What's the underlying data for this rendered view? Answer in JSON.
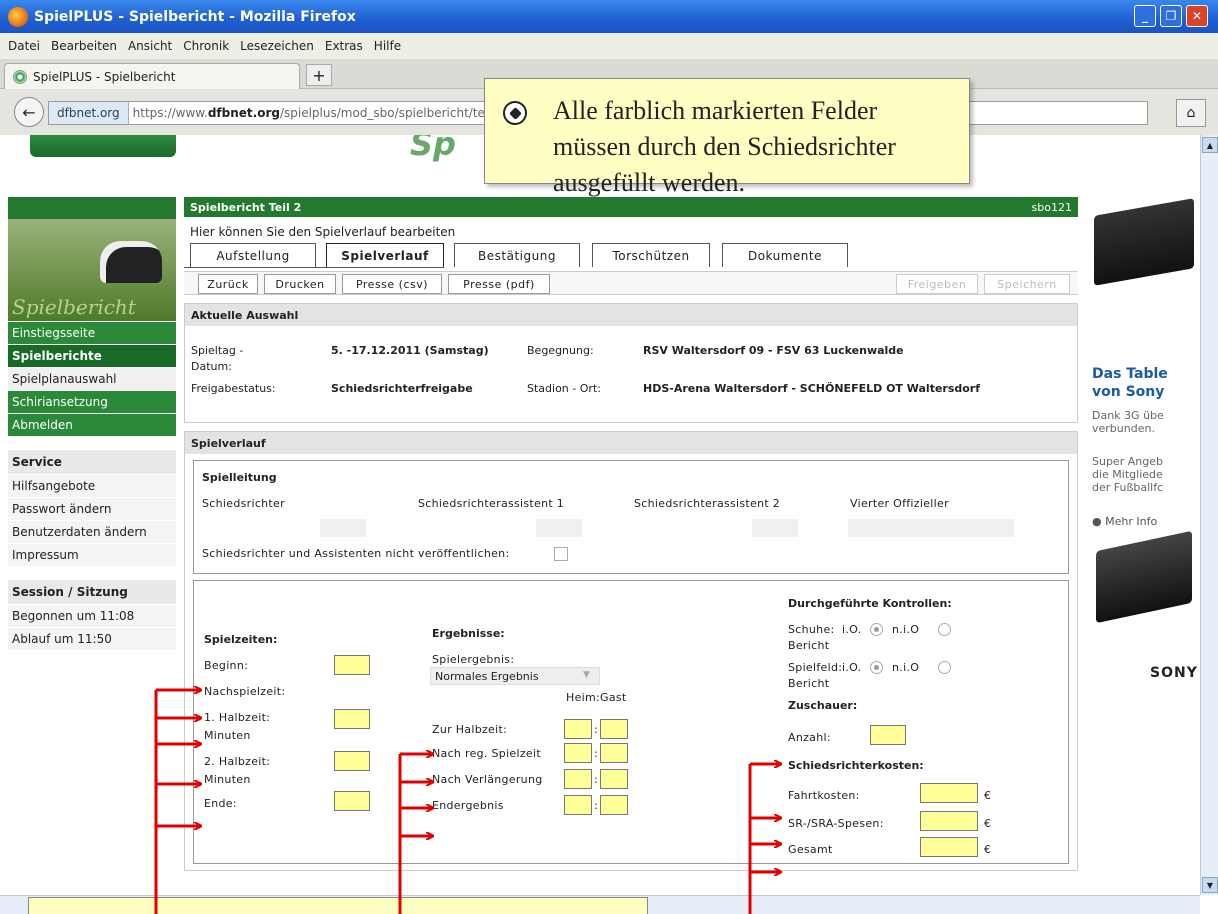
{
  "window": {
    "title": "SpielPLUS - Spielbericht - Mozilla Firefox"
  },
  "menu": [
    "Datei",
    "Bearbeiten",
    "Ansicht",
    "Chronik",
    "Lesezeichen",
    "Extras",
    "Hilfe"
  ],
  "browser_tab": {
    "label": "SpielPLUS - Spielbericht",
    "new_tab": "+"
  },
  "url": {
    "site": "dfbnet.org",
    "prefix": "https://www.",
    "domain": "dfbnet.org",
    "path": "/spielplus/mod_sbo/spielbericht/te"
  },
  "sidebar": {
    "nav": [
      {
        "label": "Einstiegsseite",
        "active": false
      },
      {
        "label": "Spielberichte",
        "active": true
      },
      {
        "label": "Spielplanauswahl",
        "active": false,
        "white": true
      },
      {
        "label": "Schiriansetzung",
        "active": false
      },
      {
        "label": "Abmelden",
        "active": false
      }
    ],
    "service_title": "Service",
    "service": [
      "Hilfsangebote",
      "Passwort ändern",
      "Benutzerdaten ändern",
      "Impressum"
    ],
    "session_title": "Session / Sitzung",
    "session": [
      "Begonnen um 11:08",
      "Ablauf um 11:50"
    ],
    "logo_text": "Spielbericht"
  },
  "header": {
    "title": "Spielbericht Teil 2",
    "code": "sbo121"
  },
  "edit_text": "Hier können Sie den Spielverlauf bearbeiten",
  "tabs": [
    "Aufstellung",
    "Spielverlauf",
    "Bestätigung",
    "Torschützen",
    "Dokumente"
  ],
  "buttons": {
    "zurueck": "Zurück",
    "drucken": "Drucken",
    "presse_csv": "Presse (csv)",
    "presse_pdf": "Presse (pdf)",
    "freigeben": "Freigeben",
    "speichern": "Speichern"
  },
  "auswahl": {
    "title": "Aktuelle Auswahl",
    "spieltag_label": "Spieltag -",
    "datum_label": "Datum:",
    "spieltag_value": "5. -17.12.2011 (Samstag)",
    "begegnung_label": "Begegnung:",
    "begegnung_value": "RSV Waltersdorf 09 - FSV 63 Luckenwalde",
    "freigabe_label": "Freigabestatus:",
    "freigabe_value": "Schiedsrichterfreigabe",
    "stadion_label": "Stadion - Ort:",
    "stadion_value": "HDS-Arena Waltersdorf - SCHÖNEFELD OT Waltersdorf"
  },
  "spielverlauf": {
    "title": "Spielverlauf",
    "leitung_title": "Spielleitung",
    "schiedsrichter": "Schiedsrichter",
    "sra1": "Schiedsrichterassistent 1",
    "sra2": "Schiedsrichterassistent 2",
    "vierter": "Vierter Offizieller",
    "nicht_veroeffentlichen": "Schiedsrichter und Assistenten nicht veröffentlichen:"
  },
  "spielzeiten": {
    "title": "Spielzeiten:",
    "beginn": "Beginn:",
    "nachspielzeit": "Nachspielzeit:",
    "h1a": "1. Halbzeit:",
    "h1b": "Minuten",
    "h2a": "2. Halbzeit:",
    "h2b": "Minuten",
    "ende": "Ende:"
  },
  "ergebnisse": {
    "title": "Ergebnisse:",
    "spielergebnis_label": "Spielergebnis:",
    "spielergebnis_value": "Normales Ergebnis",
    "heimgast": "Heim:Gast",
    "zur_halbzeit": "Zur Halbzeit:",
    "nach_reg": "Nach reg. Spielzeit",
    "nach_verl": "Nach Verlängerung",
    "endergebnis": "Endergebnis",
    "sep": ":"
  },
  "kontrollen": {
    "title": "Durchgeführte Kontrollen:",
    "schuhe": "Schuhe:",
    "spielfeld": "Spielfeld:",
    "io": "i.O.",
    "nio": "n.i.O",
    "bericht": "Bericht",
    "zuschauer_title": "Zuschauer:",
    "anzahl": "Anzahl:",
    "kosten_title": "Schiedsrichterkosten:",
    "fahrtkosten": "Fahrtkosten:",
    "spesen": "SR-/SRA-Spesen:",
    "gesamt": "Gesamt",
    "euro": "€"
  },
  "ad": {
    "title_line1": "Das Table",
    "title_line2": "von Sony",
    "text1_line1": "Dank 3G übe",
    "text1_line2": "verbunden.",
    "text2_line1": "Super Angeb",
    "text2_line2": "die Mitgliede",
    "text2_line3": "der Fußballfc",
    "more": "Mehr Info",
    "brand": "SONY"
  },
  "callout": {
    "text": "Alle farblich markierten Felder müssen durch den Schiedsrichter ausgefüllt werden."
  },
  "colors": {
    "green": "#237a2f",
    "yellow_field": "#ffff99",
    "callout_bg": "#ffffc4",
    "arrow_red": "#e00000"
  }
}
